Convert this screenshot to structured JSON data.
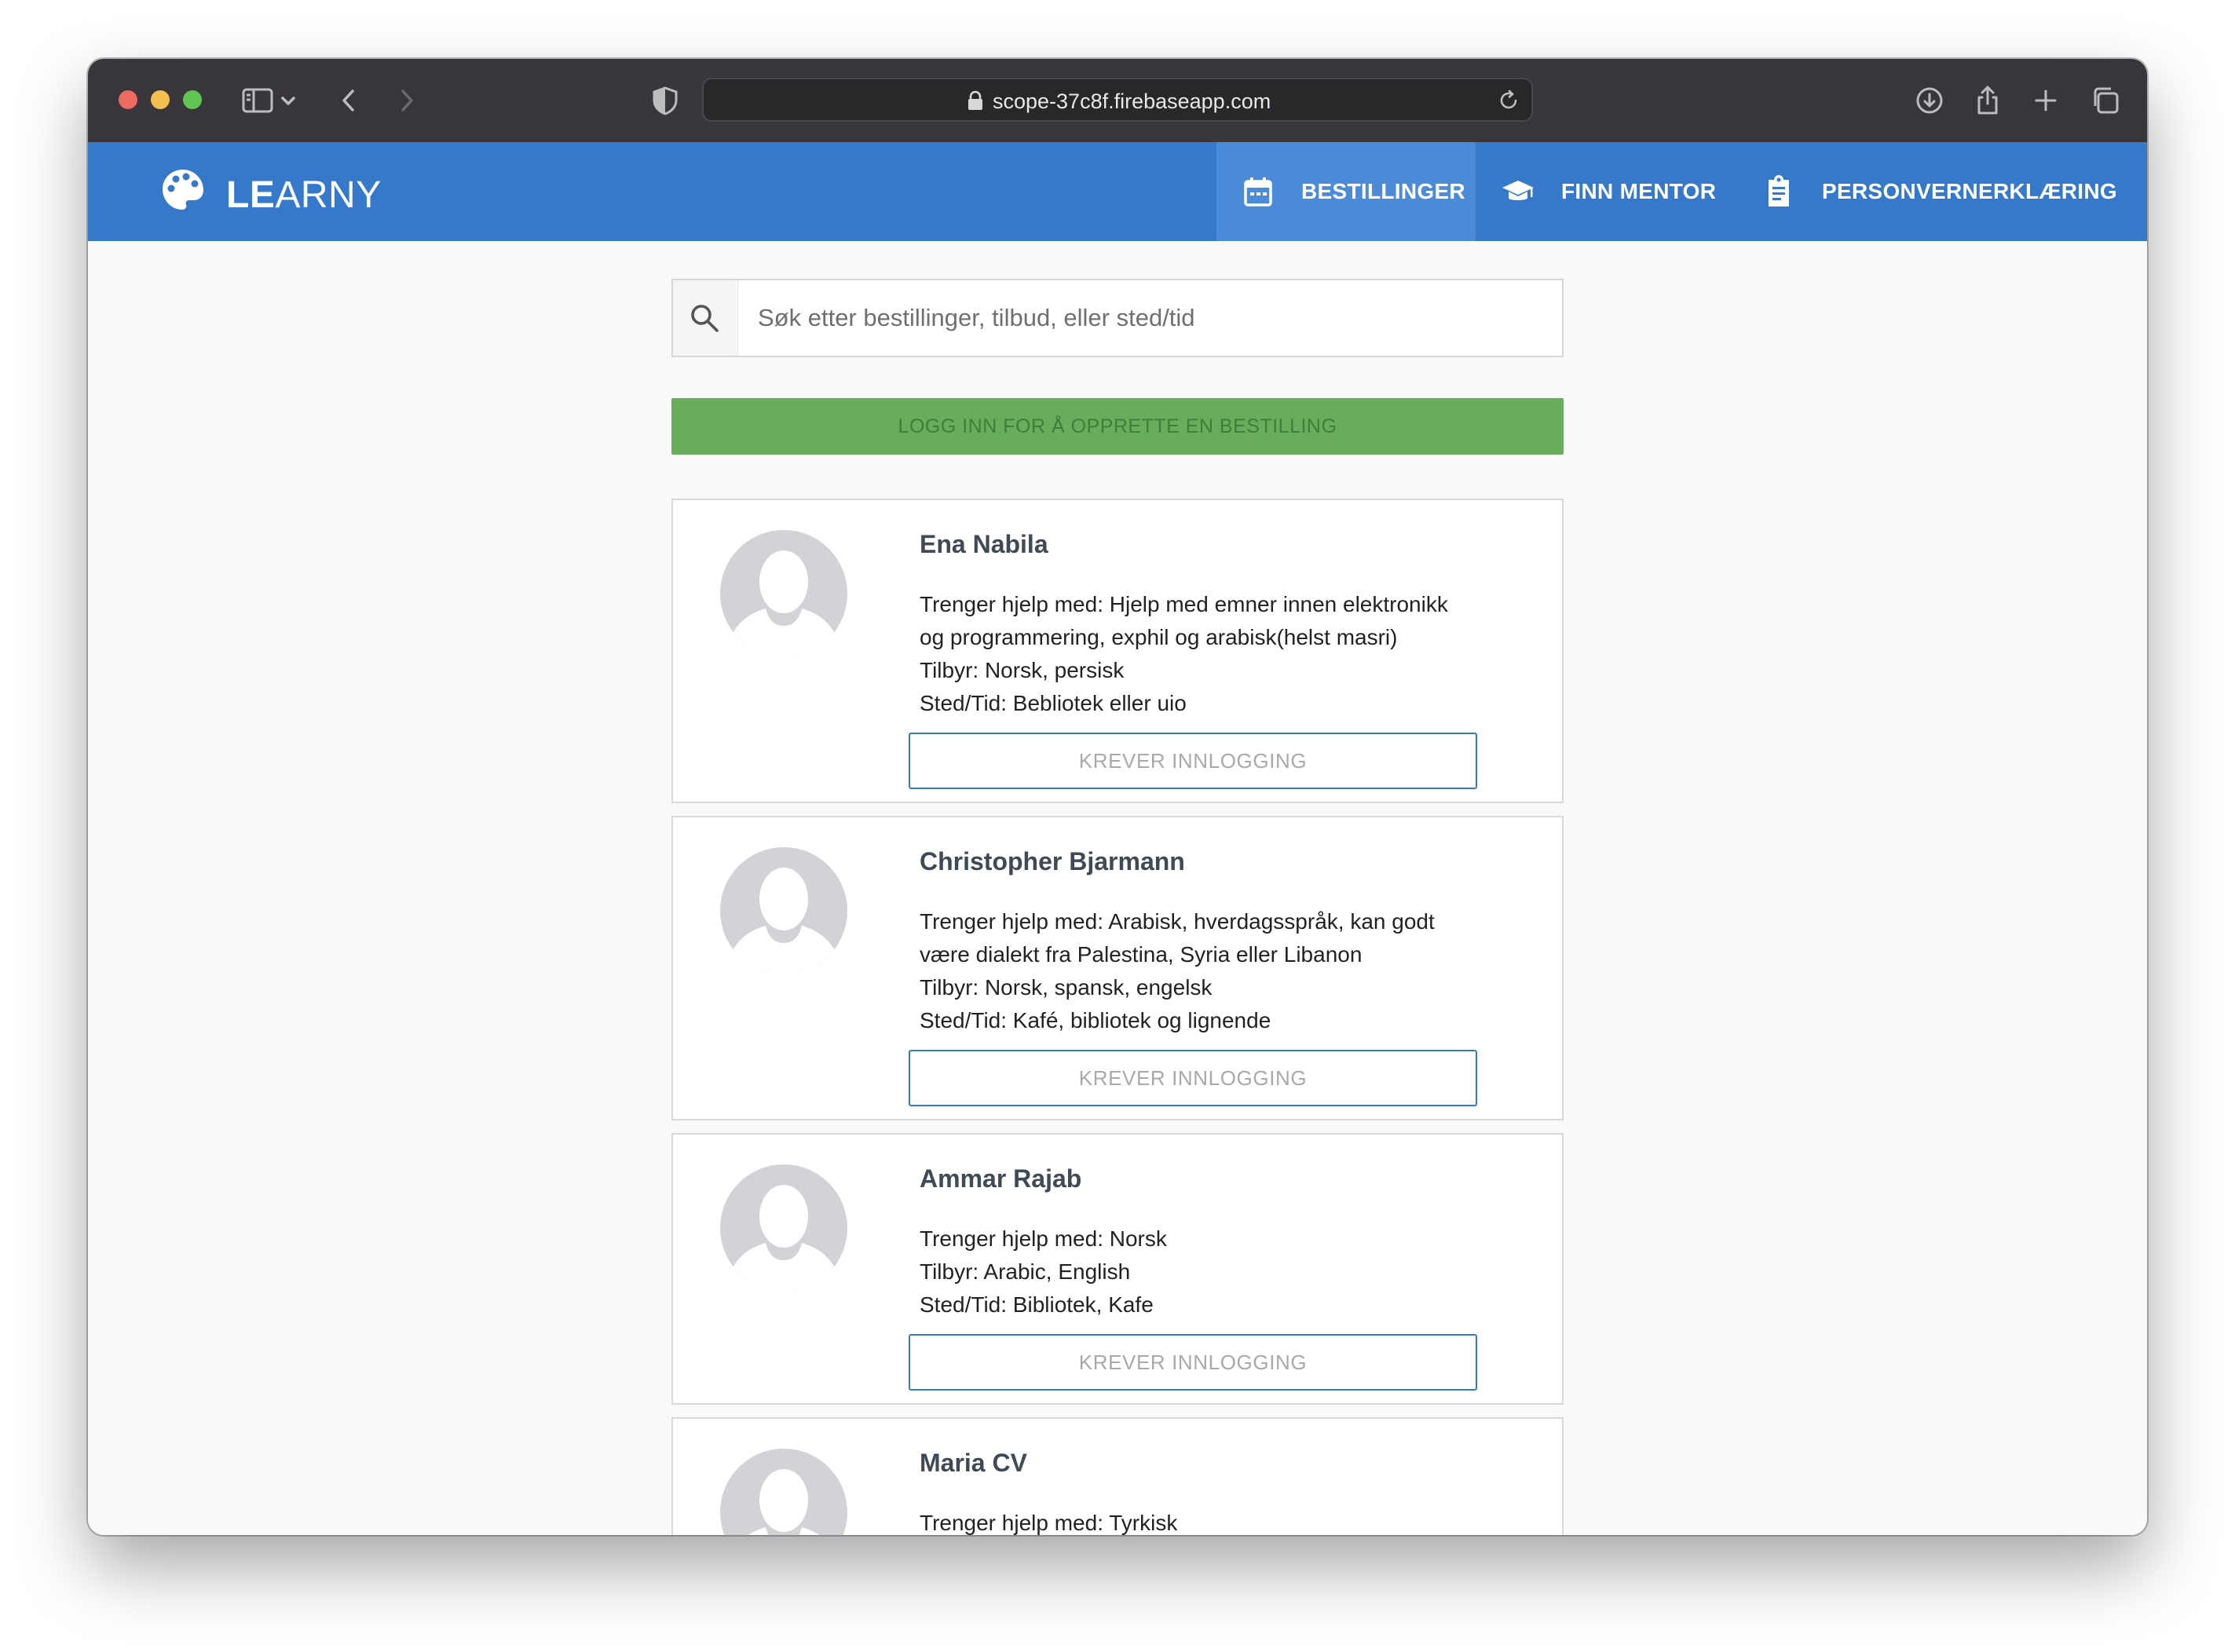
{
  "browser": {
    "url": "scope-37c8f.firebaseapp.com"
  },
  "header": {
    "brand_strong": "LE",
    "brand_light": "ARNY",
    "nav": [
      {
        "label": "BESTILLINGER",
        "icon": "calendar-icon",
        "active": true
      },
      {
        "label": "FINN MENTOR",
        "icon": "graduation-cap-icon",
        "active": false
      },
      {
        "label": "PERSONVERNERKLÆRING",
        "icon": "clipboard-icon",
        "active": false
      }
    ]
  },
  "search": {
    "placeholder": "Søk etter bestillinger, tilbud, eller sted/tid"
  },
  "login_banner": "LOGG INN FOR Å OPPRETTE EN BESTILLING",
  "cards": [
    {
      "name": "Ena Nabila",
      "lines": [
        "Trenger hjelp med: Hjelp med emner innen elektronikk",
        "og programmering, exphil og arabisk(helst masri)",
        "Tilbyr: Norsk, persisk",
        "Sted/Tid: Bebliotek eller uio"
      ],
      "button": "KREVER INNLOGGING"
    },
    {
      "name": "Christopher Bjarmann",
      "lines": [
        "Trenger hjelp med: Arabisk, hverdagsspråk, kan godt",
        "være dialekt fra Palestina, Syria eller Libanon",
        "Tilbyr: Norsk, spansk, engelsk",
        "Sted/Tid: Kafé, bibliotek og lignende"
      ],
      "button": "KREVER INNLOGGING"
    },
    {
      "name": "Ammar Rajab",
      "lines": [
        "Trenger hjelp med: Norsk",
        "Tilbyr: Arabic, English",
        "Sted/Tid: Bibliotek, Kafe"
      ],
      "button": "KREVER INNLOGGING"
    },
    {
      "name": "Maria CV",
      "lines": [
        "Trenger hjelp med: Tyrkisk"
      ],
      "button": ""
    }
  ],
  "colors": {
    "appbar": "#3679cb",
    "nav_active": "#4b8bd7",
    "login_banner": "#68ad5c",
    "button_border": "#3679cb"
  }
}
